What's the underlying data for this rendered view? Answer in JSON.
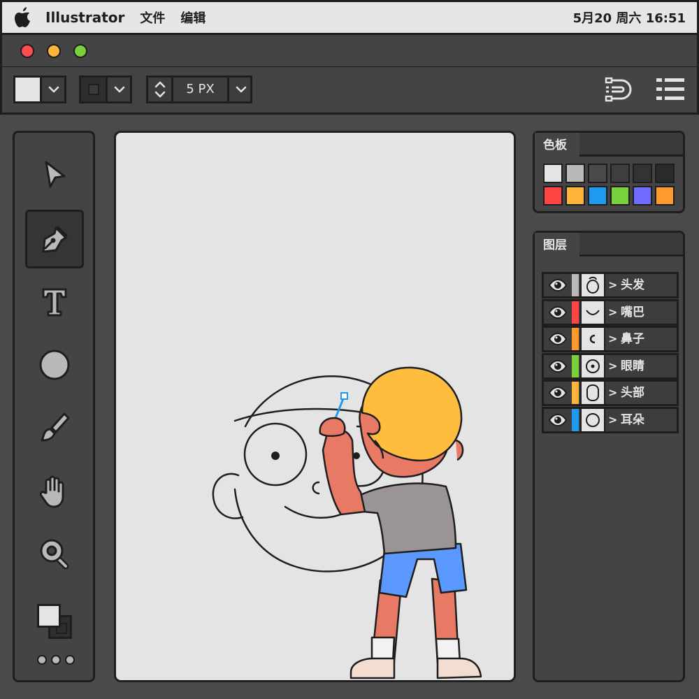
{
  "menubar": {
    "app_name": "Illustrator",
    "menus": [
      "文件",
      "编辑"
    ],
    "clock": "5月20 周六 16:51"
  },
  "toolbar": {
    "stroke_size": "5 PX"
  },
  "tools": [
    {
      "name": "selection-tool",
      "icon": "cursor-arrow-icon",
      "active": false
    },
    {
      "name": "pen-tool",
      "icon": "pen-nib-icon",
      "active": true
    },
    {
      "name": "type-tool",
      "icon": "type-t-icon",
      "active": false
    },
    {
      "name": "ellipse-tool",
      "icon": "circle-icon",
      "active": false
    },
    {
      "name": "brush-tool",
      "icon": "brush-icon",
      "active": false
    },
    {
      "name": "hand-tool",
      "icon": "hand-icon",
      "active": false
    },
    {
      "name": "zoom-tool",
      "icon": "magnifier-icon",
      "active": false
    }
  ],
  "swatches_panel": {
    "title": "色板",
    "colors": [
      "#e4e4e4",
      "#b9b9b9",
      "#4a4a4a",
      "#3e3e3e",
      "#333333",
      "#2a2a2a",
      "#ff4444",
      "#ffb43c",
      "#1e9bf0",
      "#79d13b",
      "#6f6cff",
      "#ff9a2e"
    ]
  },
  "layers_panel": {
    "title": "图层",
    "layers": [
      {
        "name": "头发",
        "color": "#b9b9b9",
        "thumb": "hair"
      },
      {
        "name": "嘴巴",
        "color": "#ff4444",
        "thumb": "mouth"
      },
      {
        "name": "鼻子",
        "color": "#ff9a2e",
        "thumb": "nose"
      },
      {
        "name": "眼睛",
        "color": "#79d13b",
        "thumb": "eye"
      },
      {
        "name": "头部",
        "color": "#ffb43c",
        "thumb": "head"
      },
      {
        "name": "耳朵",
        "color": "#1e9bf0",
        "thumb": "ear"
      }
    ]
  },
  "colors": {
    "outline": "#1e1e1e",
    "panel": "#444444",
    "canvas": "#e4e4e4",
    "skin": "#e87a65",
    "hair": "#ffbd40",
    "shirt": "#9b9496",
    "shorts": "#5c99ff",
    "selection": "#1e9bf0"
  }
}
